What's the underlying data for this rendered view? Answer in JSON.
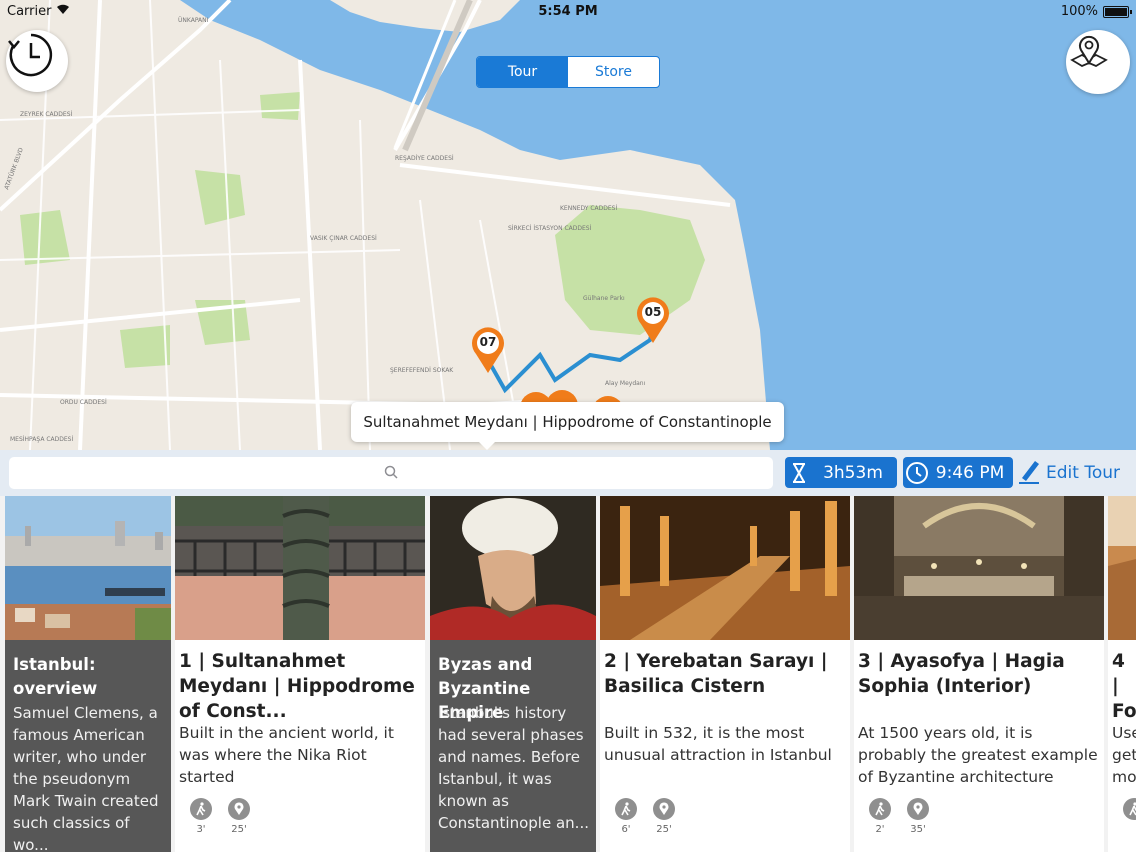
{
  "status_bar": {
    "carrier": "Carrier",
    "time": "5:54 PM",
    "battery": "100%"
  },
  "segmented": {
    "tour_label": "Tour",
    "store_label": "Store",
    "selected": "Tour"
  },
  "map": {
    "callout": "Sultanahmet Meydanı | Hippodrome of Constantinople",
    "pins": [
      {
        "label": "07"
      },
      {
        "label": "05"
      }
    ],
    "street_labels": [
      "ÜNKAPANI",
      "KENNEDY CADDESİ",
      "SİRKECİ İSTASYON CADDESİ",
      "Gülhane Parkı",
      "ORDU CADDESİ",
      "ŞEREFEFENDİ SOKAK",
      "VASIK ÇINAR CADDESİ",
      "ATATÜRK BLVD",
      "ZEYREK CADDESİ",
      "MESİHPAŞA CADDESİ",
      "Alay Meydanı",
      "REŞADİYE CADDESİ"
    ],
    "water_color": "#7fb8e8",
    "land_color": "#efeae2",
    "park_color": "#c6e1a6",
    "route_color": "#2b8fd1",
    "pin_color": "#f07c1a"
  },
  "toolbar": {
    "search_placeholder": "",
    "duration": "3h53m",
    "end_time": "9:46 PM",
    "edit_label": "Edit Tour"
  },
  "cards": [
    {
      "title": "Istanbul: overview",
      "description": "Samuel Clemens, a famous American writer, who under the pseudonym Mark Twain created such classics of wo...",
      "style": "dark"
    },
    {
      "title": "1 | Sultanahmet Meydanı | Hippodrome of Const...",
      "description": "Built in the ancient world, it was where the Nika Riot started",
      "walk": "3'",
      "visit": "25'"
    },
    {
      "title": "Byzas and Byzantine Empire",
      "description": "Istanbul's history had several phases and names. Before Istanbul, it was known as Constantinople an...",
      "style": "dark"
    },
    {
      "title": "2 | Yerebatan Sarayı | Basilica Cistern",
      "description": "Built in 532, it is the most unusual attraction in Istanbul",
      "walk": "6'",
      "visit": "25'"
    },
    {
      "title": "3 | Ayasofya | Hagia Sophia (Interior)",
      "description": "At 1500 years old, it is probably the greatest example of Byzantine architecture",
      "walk": "2'",
      "visit": "35'"
    },
    {
      "title": "4 | Fo",
      "description": "Use get- mo",
      "walk": ""
    }
  ]
}
